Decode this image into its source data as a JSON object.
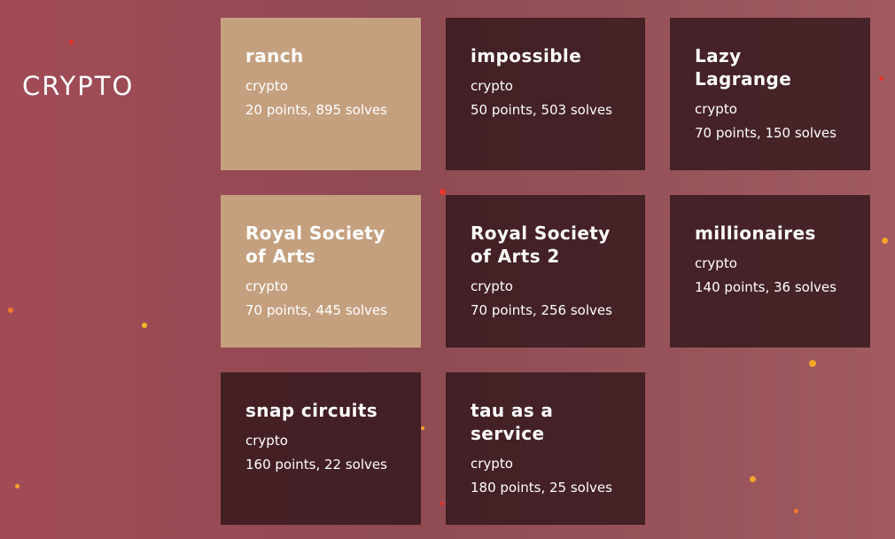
{
  "category": {
    "title": "CRYPTO"
  },
  "colors": {
    "background": "#a24b56",
    "card_solved": "#c4a07f",
    "card_unsolved": "#3f2226",
    "text": "#ffffff"
  },
  "challenges": [
    {
      "title": "ranch",
      "category": "crypto",
      "meta": "20 points, 895 solves",
      "solved": true
    },
    {
      "title": "impossible",
      "category": "crypto",
      "meta": "50 points, 503 solves",
      "solved": false
    },
    {
      "title": "Lazy Lagrange",
      "category": "crypto",
      "meta": "70 points, 150 solves",
      "solved": false
    },
    {
      "title": "Royal Society of Arts",
      "category": "crypto",
      "meta": "70 points, 445 solves",
      "solved": true
    },
    {
      "title": "Royal Society of Arts 2",
      "category": "crypto",
      "meta": "70 points, 256 solves",
      "solved": false
    },
    {
      "title": "millionaires",
      "category": "crypto",
      "meta": "140 points, 36 solves",
      "solved": false
    },
    {
      "title": "snap circuits",
      "category": "crypto",
      "meta": "160 points, 22 solves",
      "solved": false
    },
    {
      "title": "tau as a service",
      "category": "crypto",
      "meta": "180 points, 25 solves",
      "solved": false
    }
  ]
}
